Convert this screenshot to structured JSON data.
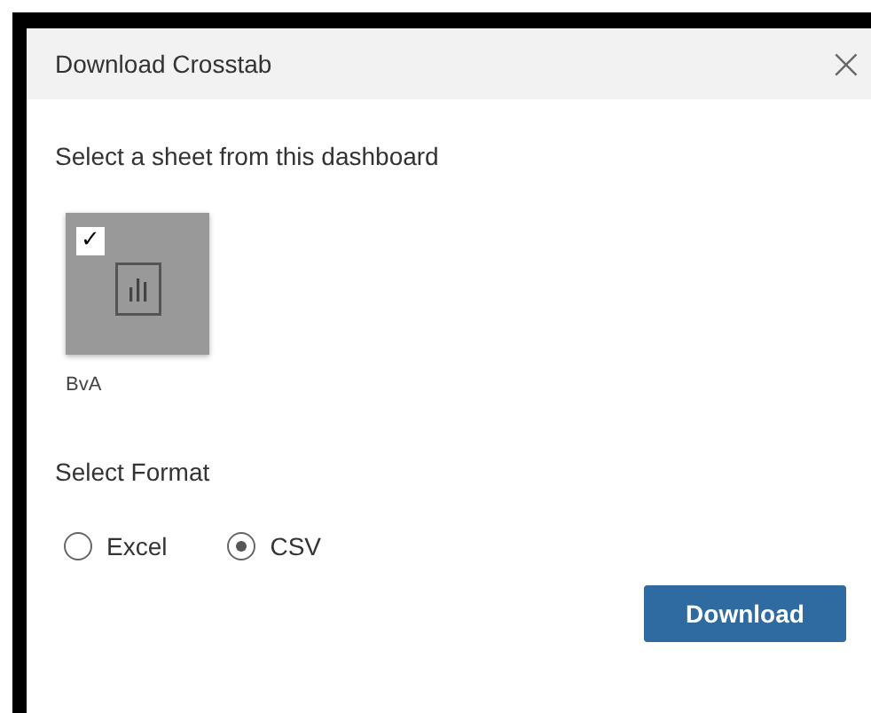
{
  "dialog": {
    "title": "Download Crosstab",
    "close": "×"
  },
  "sheet_prompt": "Select a sheet from this dashboard",
  "sheets": [
    {
      "name": "BvA",
      "checked": true,
      "check": "✓"
    }
  ],
  "format_prompt": "Select Format",
  "formats": [
    {
      "label": "Excel",
      "selected": false
    },
    {
      "label": "CSV",
      "selected": true
    }
  ],
  "download_button": "Download"
}
